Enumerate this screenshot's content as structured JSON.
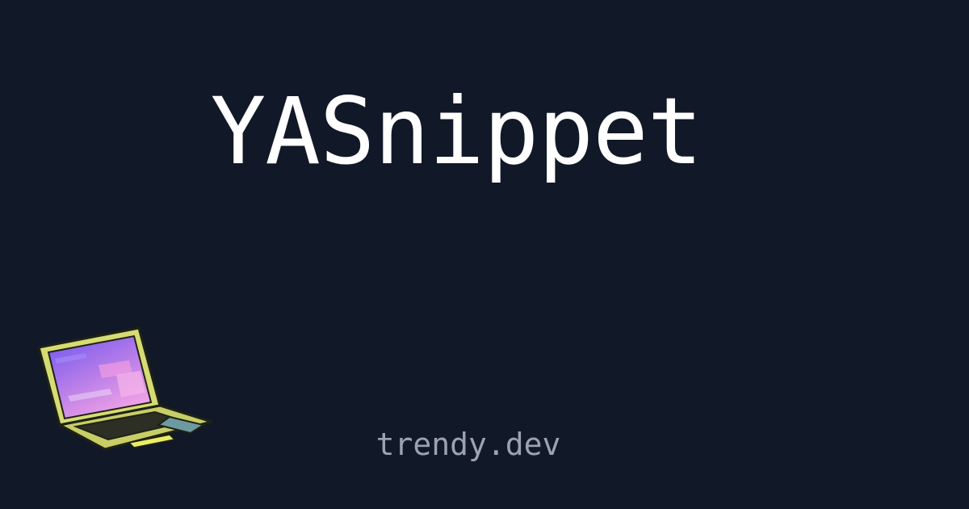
{
  "card": {
    "title": "YASnippet",
    "domain": "trendy.dev"
  },
  "colors": {
    "background": "#111827",
    "title": "#ffffff",
    "domain": "#9ca3af",
    "laptop_body": "#d6dc73",
    "laptop_outline": "#1f2215",
    "screen_top": "#7c5cf2",
    "screen_bottom": "#e08ae6",
    "keyboard": "#2d2f24"
  },
  "illustration": {
    "icon": "laptop-icon"
  }
}
